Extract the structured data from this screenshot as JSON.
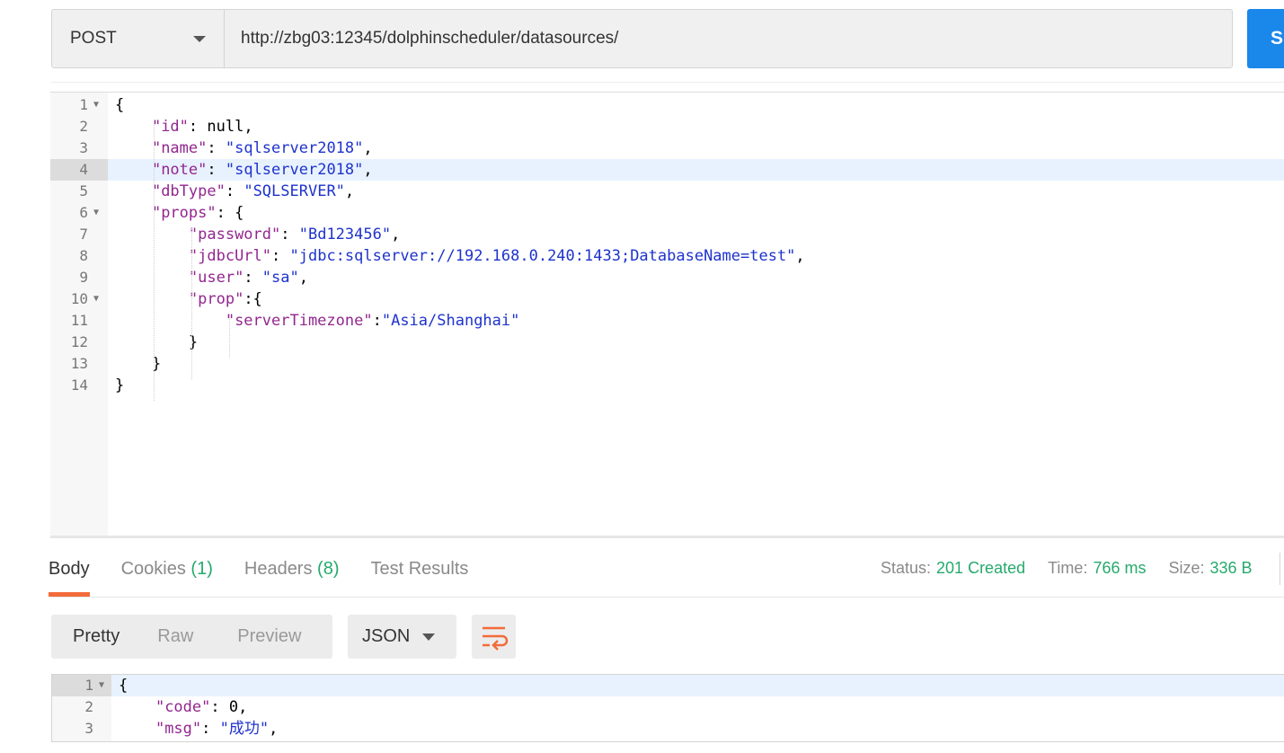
{
  "request": {
    "method": "POST",
    "url": "http://zbg03:12345/dolphinscheduler/datasources/",
    "send_label": "S"
  },
  "request_body_lines": [
    {
      "n": "1",
      "fold": true,
      "segs": [
        [
          "p",
          "{"
        ]
      ]
    },
    {
      "n": "2",
      "segs": [
        [
          "p",
          "    "
        ],
        [
          "k",
          "\"id\""
        ],
        [
          "p",
          ": null,"
        ]
      ]
    },
    {
      "n": "3",
      "segs": [
        [
          "p",
          "    "
        ],
        [
          "k",
          "\"name\""
        ],
        [
          "p",
          ": "
        ],
        [
          "s",
          "\"sqlserver2018\""
        ],
        [
          "p",
          ","
        ]
      ]
    },
    {
      "n": "4",
      "active": true,
      "segs": [
        [
          "p",
          "    "
        ],
        [
          "k",
          "\"note\""
        ],
        [
          "p",
          ": "
        ],
        [
          "s",
          "\"sqlserver2018\""
        ],
        [
          "p",
          ","
        ]
      ]
    },
    {
      "n": "5",
      "segs": [
        [
          "p",
          "    "
        ],
        [
          "k",
          "\"dbType\""
        ],
        [
          "p",
          ": "
        ],
        [
          "s",
          "\"SQLSERVER\""
        ],
        [
          "p",
          ","
        ]
      ]
    },
    {
      "n": "6",
      "fold": true,
      "segs": [
        [
          "p",
          "    "
        ],
        [
          "k",
          "\"props\""
        ],
        [
          "p",
          ": {"
        ]
      ]
    },
    {
      "n": "7",
      "segs": [
        [
          "p",
          "        "
        ],
        [
          "k",
          "\"password\""
        ],
        [
          "p",
          ": "
        ],
        [
          "s",
          "\"Bd123456\""
        ],
        [
          "p",
          ","
        ]
      ]
    },
    {
      "n": "8",
      "segs": [
        [
          "p",
          "        "
        ],
        [
          "k",
          "\"jdbcUrl\""
        ],
        [
          "p",
          ": "
        ],
        [
          "s",
          "\"jdbc:sqlserver://192.168.0.240:1433;DatabaseName=test\""
        ],
        [
          "p",
          ","
        ]
      ]
    },
    {
      "n": "9",
      "segs": [
        [
          "p",
          "        "
        ],
        [
          "k",
          "\"user\""
        ],
        [
          "p",
          ": "
        ],
        [
          "s",
          "\"sa\""
        ],
        [
          "p",
          ","
        ]
      ]
    },
    {
      "n": "10",
      "fold": true,
      "segs": [
        [
          "p",
          "        "
        ],
        [
          "k",
          "\"prop\""
        ],
        [
          "p",
          ":{"
        ]
      ]
    },
    {
      "n": "11",
      "segs": [
        [
          "p",
          "            "
        ],
        [
          "k",
          "\"serverTimezone\""
        ],
        [
          "p",
          ":"
        ],
        [
          "s",
          "\"Asia/Shanghai\""
        ]
      ]
    },
    {
      "n": "12",
      "segs": [
        [
          "p",
          "        }"
        ]
      ]
    },
    {
      "n": "13",
      "segs": [
        [
          "p",
          "    }"
        ]
      ]
    },
    {
      "n": "14",
      "segs": [
        [
          "p",
          "}"
        ]
      ]
    }
  ],
  "response_tabs": {
    "body": "Body",
    "cookies": "Cookies",
    "cookies_count": "(1)",
    "headers": "Headers",
    "headers_count": "(8)",
    "tests": "Test Results"
  },
  "status": {
    "status_label": "Status:",
    "status_value": "201 Created",
    "time_label": "Time:",
    "time_value": "766 ms",
    "size_label": "Size:",
    "size_value": "336 B"
  },
  "view": {
    "pretty": "Pretty",
    "raw": "Raw",
    "preview": "Preview",
    "format": "JSON"
  },
  "response_lines": [
    {
      "n": "1",
      "fold": true,
      "active": true,
      "segs": [
        [
          "p",
          "{"
        ]
      ]
    },
    {
      "n": "2",
      "segs": [
        [
          "p",
          "    "
        ],
        [
          "k",
          "\"code\""
        ],
        [
          "p",
          ": 0,"
        ]
      ]
    },
    {
      "n": "3",
      "segs": [
        [
          "p",
          "    "
        ],
        [
          "k",
          "\"msg\""
        ],
        [
          "p",
          ": "
        ],
        [
          "s",
          "\"成功\""
        ],
        [
          "p",
          ","
        ]
      ]
    }
  ],
  "colors": {
    "accent": "#f26b3a",
    "send": "#1a87ea",
    "status_ok": "#26a96c",
    "json_key": "#92278f",
    "json_string": "#1e33cc"
  }
}
